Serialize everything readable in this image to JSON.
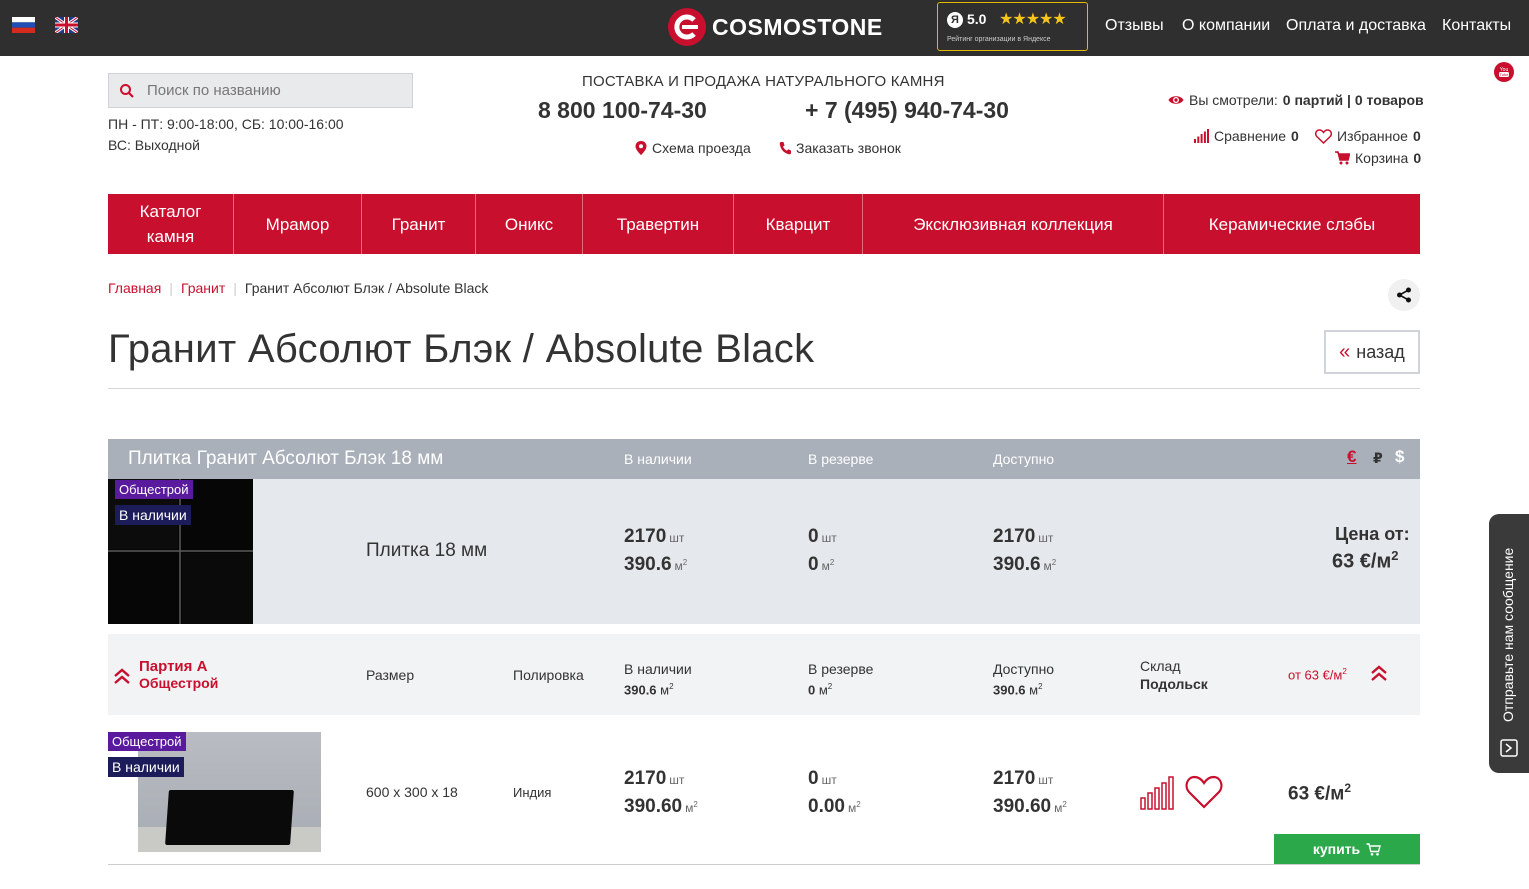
{
  "topbar": {
    "brand": "COSMOSTONE",
    "rating_score": "5.0",
    "rating_stars": "★★★★★",
    "rating_caption": "Рейтинг организации в Яндексе",
    "nav": [
      "Отзывы",
      "О компании",
      "Оплата и доставка",
      "Контакты"
    ]
  },
  "header": {
    "search_placeholder": "Поиск по названию",
    "hours_weekday": "ПН - ПТ: 9:00-18:00, СБ: 10:00-16:00",
    "hours_sunday": "ВС: Выходной",
    "tagline": "ПОСТАВКА И ПРОДАЖА НАТУРАЛЬНОГО КАМНЯ",
    "phone_1": "8 800 100-74-30",
    "phone_2": "+ 7 (495) 940-74-30",
    "directions": "Схема проезда",
    "callback": "Заказать звонок",
    "viewed_label": "Вы смотрели:",
    "viewed_value": "0 партий | 0 товаров",
    "compare_label": "Сравнение",
    "compare_count": "0",
    "favorites_label": "Избранное",
    "favorites_count": "0",
    "cart_label": "Корзина",
    "cart_count": "0"
  },
  "mainnav": {
    "catalog_line1": "Каталог",
    "catalog_line2": "камня",
    "items": [
      "Мрамор",
      "Гранит",
      "Оникс",
      "Травертин",
      "Кварцит",
      "Эксклюзивная коллекция",
      "Керамические слэбы"
    ]
  },
  "breadcrumb": {
    "home": "Главная",
    "section": "Гранит",
    "current": "Гранит Абсолют Блэк / Absolute Black"
  },
  "page": {
    "title": "Гранит Абсолют Блэк / Absolute Black",
    "back_label": "назад"
  },
  "table": {
    "header_name": "Плитка Гранит Абсолют Блэк 18 мм",
    "col_in_stock": "В наличии",
    "col_reserved": "В резерве",
    "col_available": "Доступно",
    "currencies": [
      "€",
      "₽",
      "$"
    ]
  },
  "product": {
    "badge_supplier": "Общестрой",
    "badge_status": "В наличии",
    "name": "Плитка 18 мм",
    "in_stock_pcs": "2170",
    "in_stock_m2": "390.6",
    "reserved_pcs": "0",
    "reserved_m2": "0",
    "available_pcs": "2170",
    "available_m2": "390.6",
    "unit_pcs": "шт",
    "unit_m": "м",
    "unit_sq": "2",
    "price_label": "Цена от:",
    "price_value": "63 €/м"
  },
  "lot": {
    "name": "Партия А",
    "supplier": "Общестрой",
    "size_label": "Размер",
    "polish_label": "Полировка",
    "in_stock_label": "В наличии",
    "in_stock_value": "390.6",
    "reserved_label": "В резерве",
    "reserved_value": "0",
    "available_label": "Доступно",
    "available_value": "390.6",
    "warehouse_label": "Склад",
    "warehouse_value": "Подольск",
    "price": "от 63 €/м"
  },
  "item": {
    "badge_supplier": "Общестрой",
    "badge_status": "В наличии",
    "size": "600 x 300 x 18",
    "origin": "Индия",
    "in_stock_pcs": "2170",
    "in_stock_m2": "390.60",
    "reserved_pcs": "0",
    "reserved_m2": "0.00",
    "available_pcs": "2170",
    "available_m2": "390.60",
    "price": "63 €/м",
    "buy_label": "купить"
  },
  "feedback": {
    "label": "Отправьте нам сообщение"
  },
  "colors": {
    "brand_red": "#c8102e",
    "topbar": "#2f2f2f",
    "buy_green": "#2ba84a",
    "table_header": "#a9b0ba"
  }
}
